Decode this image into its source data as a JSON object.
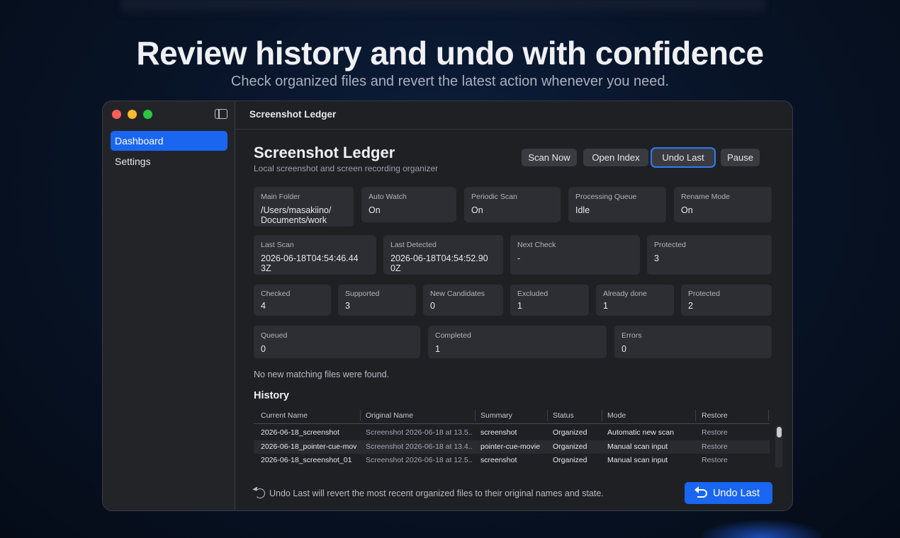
{
  "hero": {
    "title": "Review history and undo with confidence",
    "subtitle": "Check organized files and revert the latest action whenever you need."
  },
  "sidebar": {
    "items": [
      {
        "label": "Dashboard",
        "active": true
      },
      {
        "label": "Settings",
        "active": false
      }
    ]
  },
  "window": {
    "title": "Screenshot Ledger"
  },
  "header": {
    "title": "Screenshot Ledger",
    "subtitle": "Local screenshot and screen recording organizer",
    "buttons": {
      "scan_now": "Scan Now",
      "open_index": "Open Index",
      "undo_last": "Undo Last",
      "pause": "Pause"
    }
  },
  "status": {
    "row1": [
      {
        "label": "Main Folder",
        "value": "/Users/masakiino/\nDocuments/work"
      },
      {
        "label": "Auto Watch",
        "value": "On"
      },
      {
        "label": "Periodic Scan",
        "value": "On"
      },
      {
        "label": "Processing Queue",
        "value": "Idle"
      },
      {
        "label": "Rename Mode",
        "value": "On"
      }
    ],
    "row2": [
      {
        "label": "Last Scan",
        "value": "2026-06-18T04:54:46.44\n3Z"
      },
      {
        "label": "Last Detected",
        "value": "2026-06-18T04:54:52.90\n0Z"
      },
      {
        "label": "Next Check",
        "value": "-"
      },
      {
        "label": "Protected",
        "value": "3"
      }
    ],
    "row3": [
      {
        "label": "Checked",
        "value": "4"
      },
      {
        "label": "Supported",
        "value": "3"
      },
      {
        "label": "New Candidates",
        "value": "0"
      },
      {
        "label": "Excluded",
        "value": "1"
      },
      {
        "label": "Already done",
        "value": "1"
      },
      {
        "label": "Protected",
        "value": "2"
      }
    ],
    "row4": [
      {
        "label": "Queued",
        "value": "0"
      },
      {
        "label": "Completed",
        "value": "1"
      },
      {
        "label": "Errors",
        "value": "0"
      }
    ]
  },
  "info_message": "No new matching files were found.",
  "history": {
    "title": "History",
    "columns": [
      "Current Name",
      "Original Name",
      "Summary",
      "Status",
      "Mode",
      "Restore"
    ],
    "rows": [
      {
        "current": "2026-06-18_screenshot",
        "original": "Screenshot 2026-06-18 at 13.5...",
        "summary": "screenshot",
        "status": "Organized",
        "mode": "Automatic new scan",
        "restore": "Restore"
      },
      {
        "current": "2026-06-18_pointer-cue-mov",
        "original": "Screenshot 2026-06-18 at 13.4...",
        "summary": "pointer-cue-movie",
        "status": "Organized",
        "mode": "Manual scan input",
        "restore": "Restore"
      },
      {
        "current": "2026-06-18_screenshot_01",
        "original": "Screenshot 2026-06-18 at 12.5...",
        "summary": "screenshot",
        "status": "Organized",
        "mode": "Manual scan input",
        "restore": "Restore"
      }
    ]
  },
  "footer": {
    "note": "Undo Last will revert the most recent organized files to their original names and state.",
    "primary_button": "Undo Last"
  },
  "colors": {
    "accent": "#1a66f0",
    "window_bg": "#1f2024",
    "card_bg": "#2d2e33"
  }
}
